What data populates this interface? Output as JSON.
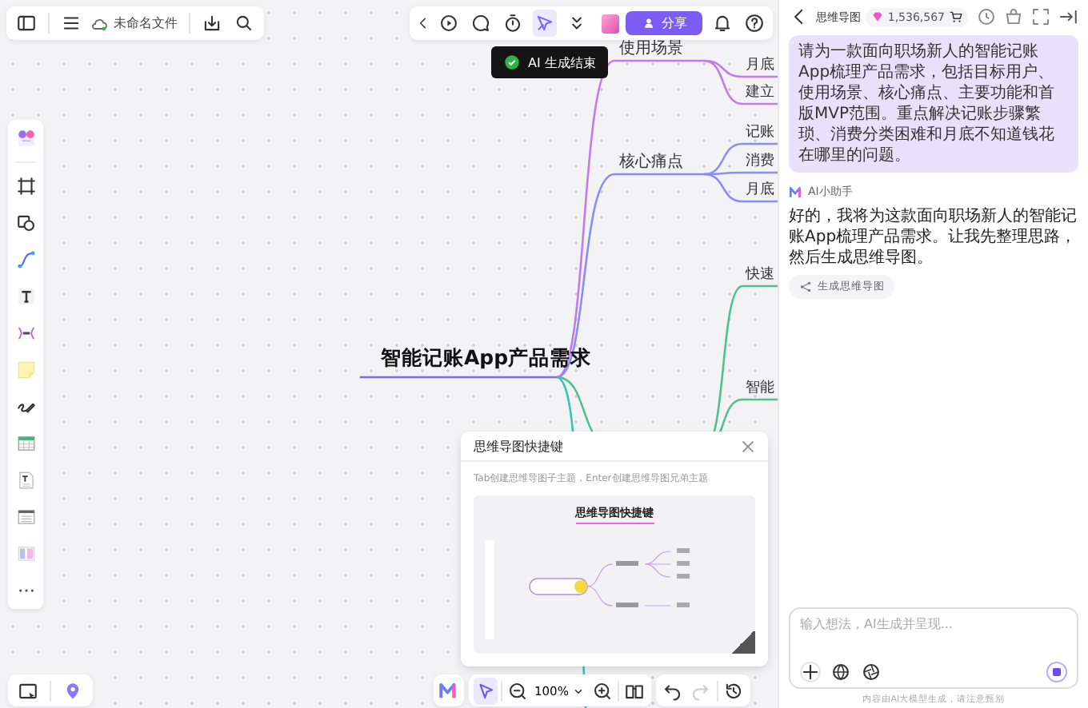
{
  "top_left_toolbar": {
    "file_name": "未命名文件"
  },
  "top_toolbar": {
    "tools": [
      {
        "kind": "play",
        "selected": false
      },
      {
        "kind": "comment",
        "selected": false
      },
      {
        "kind": "timer",
        "selected": false
      },
      {
        "kind": "laser",
        "selected": true
      },
      {
        "kind": "more",
        "selected": false
      }
    ],
    "share_button": "分享"
  },
  "toast": {
    "text": "AI 生成结束"
  },
  "left_rail": {
    "tools": [
      {
        "kind": "templates"
      },
      {
        "kind": "frame"
      },
      {
        "kind": "shapes"
      },
      {
        "kind": "connector"
      },
      {
        "kind": "text"
      },
      {
        "kind": "mindmap"
      },
      {
        "kind": "sticky"
      },
      {
        "kind": "pen"
      },
      {
        "kind": "table"
      },
      {
        "kind": "document"
      },
      {
        "kind": "list"
      },
      {
        "kind": "kanban"
      },
      {
        "kind": "more"
      }
    ]
  },
  "mind_map": {
    "root": "智能记账App产品需求",
    "branches": [
      {
        "label": "使用场景",
        "color": "#c27be8",
        "children": [
          {
            "label": "月底"
          },
          {
            "label": "建立"
          }
        ]
      },
      {
        "label": "核心痛点",
        "color": "#8b8cf6",
        "children": [
          {
            "label": "记账"
          },
          {
            "label": "消费"
          },
          {
            "label": "月底"
          }
        ]
      },
      {
        "color": "#4fc28c",
        "children": [
          {
            "label": "快速"
          },
          {
            "label": "智能"
          }
        ]
      }
    ]
  },
  "shortcut_popup": {
    "title": "思维导图快捷键",
    "description": "Tab创建思维导图子主题，Enter创建思维导图兄弟主题",
    "preview_title": "思维导图快捷键"
  },
  "bottom_toolbar": {
    "zoom": "100%",
    "select_selected": true,
    "redo_disabled": true
  },
  "chat_panel": {
    "title": "思维导图",
    "credits": "1,536,567",
    "messages": [
      {
        "kind": "user",
        "text": "请为一款面向职场新人的智能记账App梳理产品需求，包括目标用户、使用场景、核心痛点、主要功能和首版MVP范围。重点解决记账步骤繁琐、消费分类困难和月底不知道钱花在哪里的问题。"
      },
      {
        "kind": "assistant",
        "sender": "AI小助手",
        "text": "好的，我将为这款面向职场新人的智能记账App梳理产品需求。让我先整理思路，然后生成思维导图。",
        "action": "生成思维导图"
      }
    ],
    "input": {
      "placeholder": "输入想法，AI生成并呈现..."
    },
    "disclaimer": "内容由AI大模型生成，请注意甄别"
  }
}
